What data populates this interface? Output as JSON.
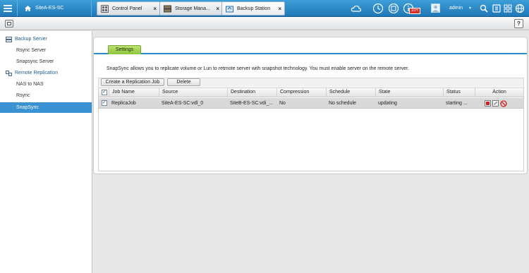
{
  "header": {
    "host_label": "SiteA-ES-SC",
    "tabs": [
      {
        "label": "Control Panel",
        "close": "×"
      },
      {
        "label": "Storage Mana...",
        "close": "×"
      },
      {
        "label": "Backup Station",
        "close": "×"
      }
    ],
    "notification_badge": "10+",
    "user": "admin",
    "user_caret": "▾"
  },
  "help": "?",
  "sidebar": {
    "groups": [
      {
        "label": "Backup Server",
        "items": [
          "Rsync Server",
          "Snapsync Server"
        ]
      },
      {
        "label": "Remote Replication",
        "items": [
          "NAS to NAS",
          "Rsync",
          "SnapSync"
        ]
      }
    ],
    "active_item": "SnapSync"
  },
  "content": {
    "tab": "Settings",
    "description": "SnapSync allows you to replicate volume or Lun to retmote server with snapshot technology. You must enable server on the remote server.",
    "buttons": {
      "create": "Create a Replication Job",
      "delete": "Delete"
    },
    "columns": [
      "Job Name",
      "Source",
      "Destination",
      "Compression",
      "Schedule",
      "State",
      "Status",
      "Action"
    ],
    "rows": [
      {
        "job_name": "ReplicaJob",
        "source": "SiteA-ES-SC:vdl_0",
        "destination": "SiteB-ES-SC:vdi_...",
        "compression": "No",
        "schedule": "No schedule",
        "state": "updating",
        "status": "starting ...",
        "checked": true
      }
    ],
    "check_mark": "✓"
  },
  "colors": {
    "accent": "#2e8ad0",
    "topbar": "#1f78b6",
    "selected": "#3a92d3",
    "tab_green": "#8cc63e"
  }
}
